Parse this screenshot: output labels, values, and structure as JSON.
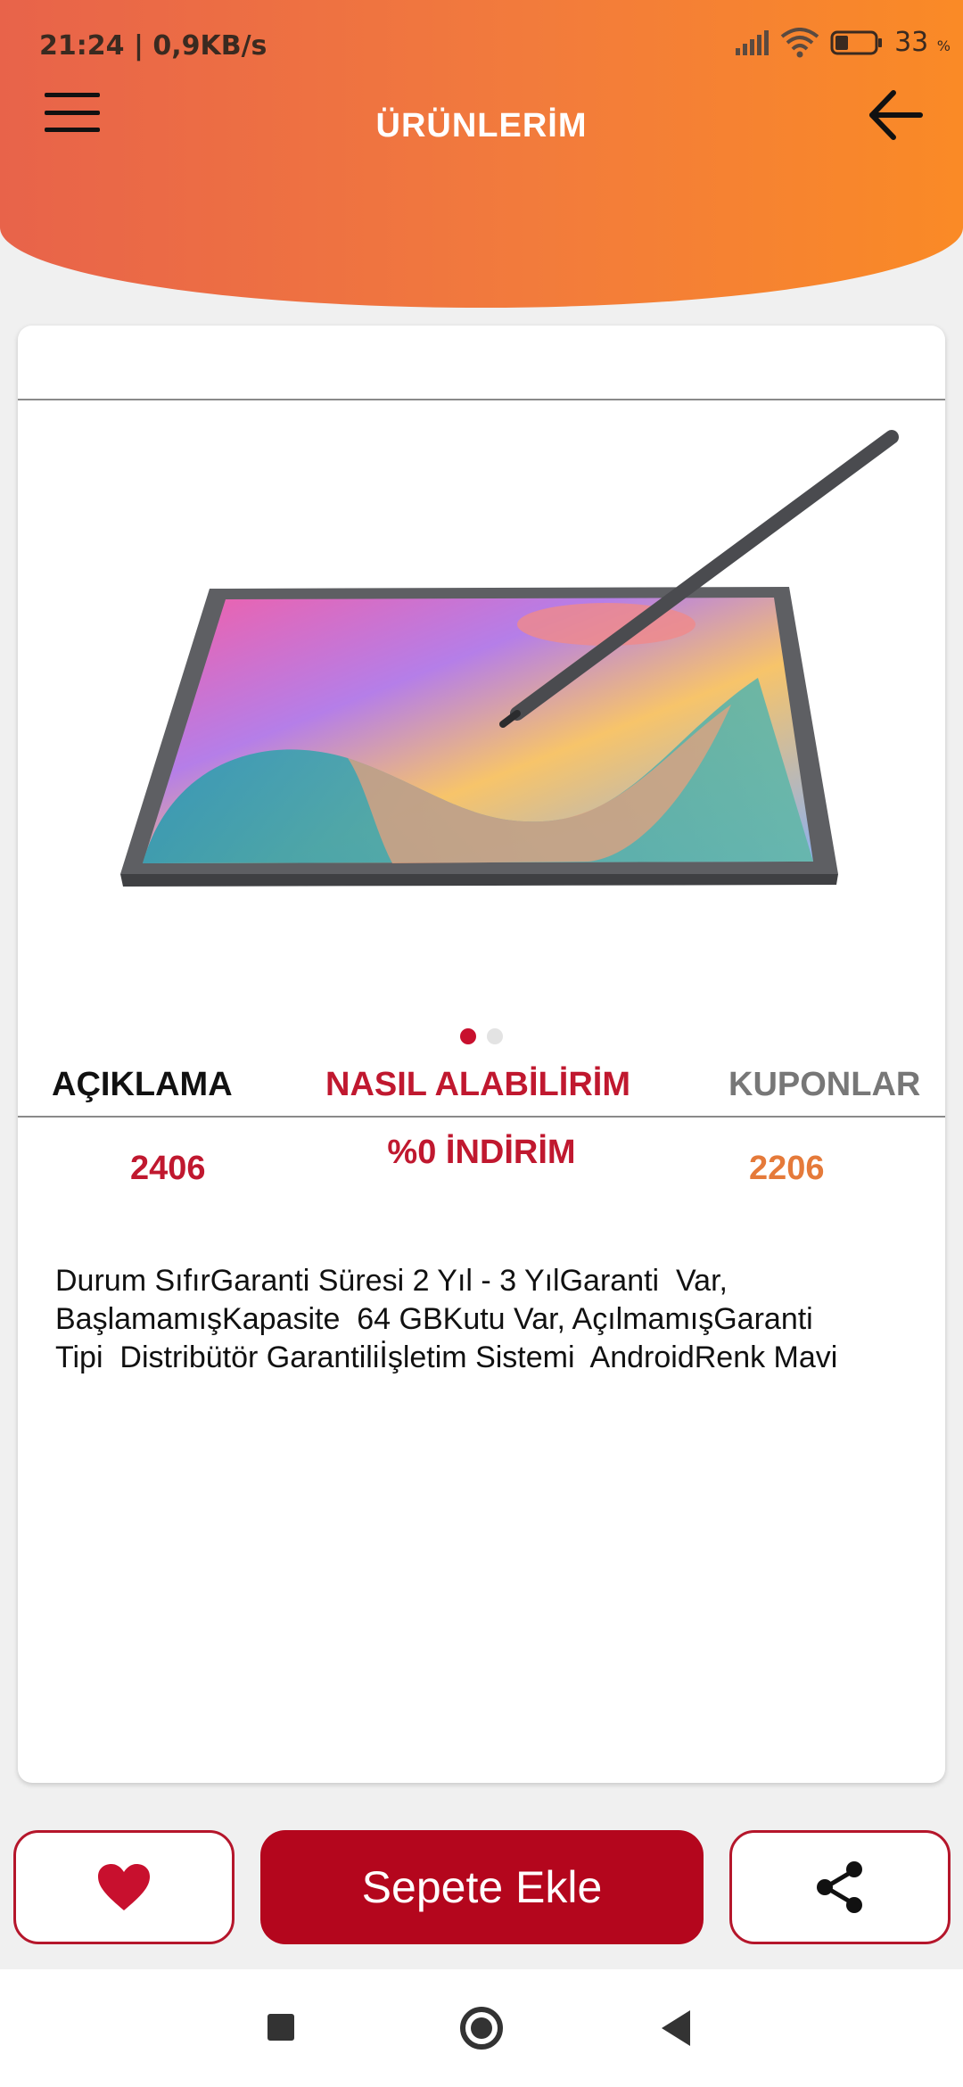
{
  "status_bar": {
    "time_speed": "21:24 | 0,9KB/s",
    "battery": "33",
    "battery_unit": "%"
  },
  "header": {
    "title": "ÜRÜNLERİM",
    "menu_icon": "hamburger-menu-icon",
    "back_icon": "arrow-left-icon"
  },
  "product": {
    "image": "tablet-with-stylus-image",
    "carousel": {
      "total": 2,
      "active": 0
    },
    "tabs": [
      "AÇIKLAMA",
      "NASIL ALABİLİRİM",
      "KUPONLAR"
    ],
    "stats": {
      "left": "2406",
      "middle": "%0 İNDİRİM",
      "right": "2206"
    },
    "description": "Durum SıfırGaranti Süresi 2 Yıl - 3 YılGaranti  Var,\nBaşlamamışKapasite  64 GBKutu Var, AçılmamışGaranti\nTipi  Distribütör Garantiliİşletim Sistemi  AndroidRenk Mavi"
  },
  "actions": {
    "favorite_icon": "heart-icon",
    "add_to_cart": "Sepete Ekle",
    "share_icon": "share-icon"
  },
  "colors": {
    "accent_red": "#b4061d",
    "header_start": "#e8634a",
    "header_end": "#fa8a26",
    "orange_stat": "#e57a3a"
  }
}
